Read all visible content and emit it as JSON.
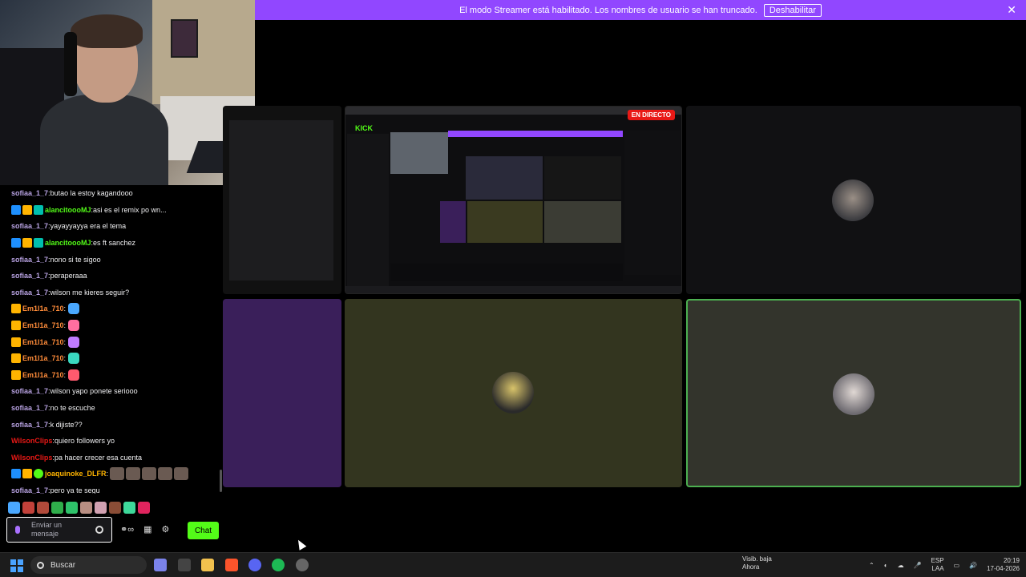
{
  "banner": {
    "text": "El modo Streamer está habilitado. Los nombres de usuario se han truncado.",
    "button": "Deshabilitar",
    "close": "✕"
  },
  "chat": {
    "messages": [
      {
        "user": "sofiaa_1_7",
        "color": "#b9a3e3",
        "text": "butao la estoy kagandooo",
        "badges": []
      },
      {
        "user": "alancitoooMJ",
        "color": "#53fc18",
        "text": "asi es el remix po wn...",
        "badges": [
          "b1",
          "b2",
          "b3"
        ]
      },
      {
        "user": "sofiaa_1_7",
        "color": "#b9a3e3",
        "text": "yayayyayya era el tema",
        "badges": []
      },
      {
        "user": "alancitoooMJ",
        "color": "#53fc18",
        "text": "es ft sanchez",
        "badges": [
          "b1",
          "b2",
          "b3"
        ]
      },
      {
        "user": "sofiaa_1_7",
        "color": "#b9a3e3",
        "text": "nono si te sigoo",
        "badges": []
      },
      {
        "user": "sofiaa_1_7",
        "color": "#b9a3e3",
        "text": "peraperaaa",
        "badges": []
      },
      {
        "user": "sofiaa_1_7",
        "color": "#b9a3e3",
        "text": "wilson me kieres seguir?",
        "badges": []
      },
      {
        "user": "Em1l1a_710",
        "color": "#ff8c3a",
        "text": "",
        "badges": [
          "b2"
        ],
        "emote": "#4aa8ff"
      },
      {
        "user": "Em1l1a_710",
        "color": "#ff8c3a",
        "text": "",
        "badges": [
          "b2"
        ],
        "emote": "#ff6fa0"
      },
      {
        "user": "Em1l1a_710",
        "color": "#ff8c3a",
        "text": "",
        "badges": [
          "b2"
        ],
        "emote": "#c07bff"
      },
      {
        "user": "Em1l1a_710",
        "color": "#ff8c3a",
        "text": "",
        "badges": [
          "b2"
        ],
        "emote": "#3ad8c0"
      },
      {
        "user": "Em1l1a_710",
        "color": "#ff8c3a",
        "text": "",
        "badges": [
          "b2"
        ],
        "emote": "#ff5a6e"
      },
      {
        "user": "sofiaa_1_7",
        "color": "#b9a3e3",
        "text": "wilson yapo ponete seriooo",
        "badges": []
      },
      {
        "user": "sofiaa_1_7",
        "color": "#b9a3e3",
        "text": "no te escuche",
        "badges": []
      },
      {
        "user": "sofiaa_1_7",
        "color": "#b9a3e3",
        "text": "k dijiste??",
        "badges": []
      },
      {
        "user": "WilsonClips",
        "color": "#e91916",
        "text": "quiero followers yo",
        "badges": []
      },
      {
        "user": "WilsonClips",
        "color": "#e91916",
        "text": "pa hacer crecer esa cuenta",
        "badges": []
      },
      {
        "user": "joaquinoke_DLFR",
        "color": "#ffb400",
        "text": "",
        "badges": [
          "b1",
          "b2",
          "b4"
        ],
        "faces": 5
      },
      {
        "user": "sofiaa_1_7",
        "color": "#b9a3e3",
        "text": "pero ya te segu",
        "badges": []
      }
    ],
    "input_placeholder": "Enviar un mensaje",
    "send_label": "Chat"
  },
  "stream": {
    "live_label": "EN DIRECTO",
    "kick_logo": "KICK"
  },
  "taskbar": {
    "search_placeholder": "Buscar",
    "weather_title": "Visib. baja",
    "weather_sub": "Ahora",
    "lang_top": "ESP",
    "lang_bottom": "LAA",
    "time": "20:19",
    "date": "17-04-2026"
  },
  "colors": {
    "accent_purple": "#9147ff",
    "kick_green": "#53fc18",
    "speaking_border": "#4caf50"
  }
}
